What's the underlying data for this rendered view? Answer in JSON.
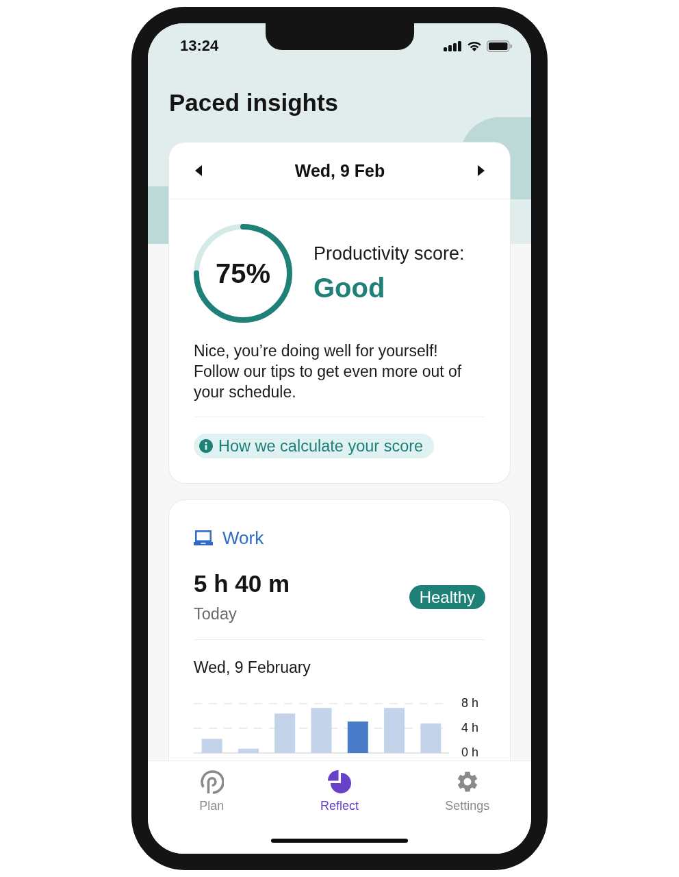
{
  "status_bar": {
    "time": "13:24"
  },
  "title": "Paced insights",
  "date_nav": {
    "label": "Wed, 9 Feb"
  },
  "score": {
    "value": "75%",
    "level": 0.75,
    "label": "Productivity score:",
    "rating": "Good",
    "message": "Nice, you’re doing well for yourself! Follow our tips to get even more out of your schedule.",
    "link": "How we calculate your score"
  },
  "activity": {
    "name": "Work",
    "duration": "5 h 40 m",
    "period": "Today",
    "status": "Healthy",
    "date": "Wed, 9 February",
    "chart_data": {
      "type": "bar",
      "stacked": true,
      "ylim": [
        0,
        8
      ],
      "yticks": [
        {
          "value": 0,
          "label": "0 h"
        },
        {
          "value": 4,
          "label": "4 h"
        },
        {
          "value": 8,
          "label": "8 h"
        }
      ],
      "series": [
        {
          "color": "#c3d3ea",
          "values": [
            2.3,
            0.7,
            6.4,
            7.3,
            null,
            7.3,
            4.8
          ]
        },
        {
          "color": "#4a7bc9",
          "values": [
            null,
            null,
            null,
            null,
            5.1,
            null,
            null
          ]
        }
      ]
    }
  },
  "nav": [
    {
      "label": "Plan",
      "selected": false
    },
    {
      "label": "Reflect",
      "selected": true
    },
    {
      "label": "Settings",
      "selected": false
    }
  ]
}
